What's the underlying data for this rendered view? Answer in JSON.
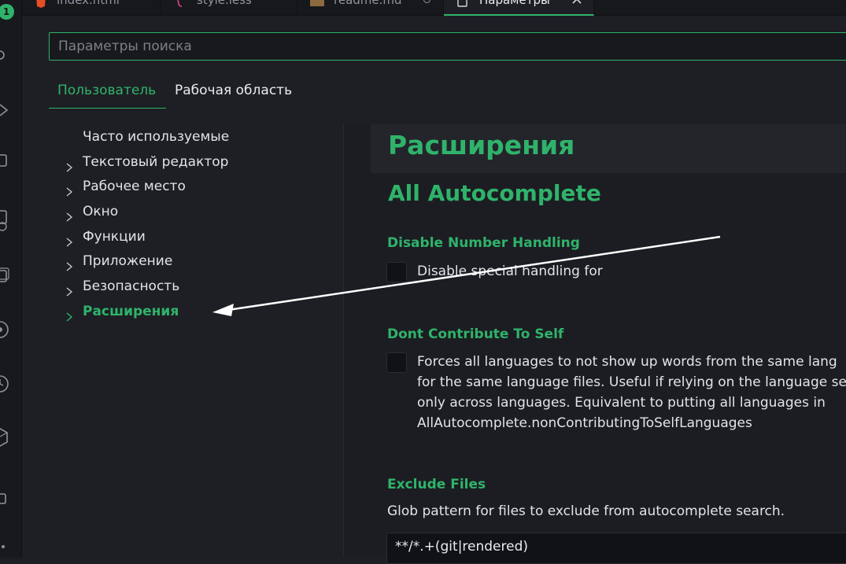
{
  "activity_bar": {
    "badge_count": "1"
  },
  "tabs": [
    {
      "label": "index.html",
      "icon": "html-file-icon",
      "icon_color": "#e44d26"
    },
    {
      "label": "style.less",
      "icon": "less-file-icon",
      "icon_color": "#d6478b"
    },
    {
      "label": "readme.md",
      "icon": "markdown-file-icon",
      "icon_color": "#8b6b3e"
    },
    {
      "label": "Параметры",
      "icon": "settings-file-icon",
      "icon_color": "#d4d6db"
    }
  ],
  "search": {
    "placeholder": "Параметры поиска",
    "value": ""
  },
  "scope_tabs": {
    "user": "Пользователь",
    "workspace": "Рабочая область"
  },
  "toc": [
    {
      "label": "Часто используемые",
      "expandable": false
    },
    {
      "label": "Текстовый редактор",
      "expandable": true
    },
    {
      "label": "Рабочее место",
      "expandable": true
    },
    {
      "label": "Окно",
      "expandable": true
    },
    {
      "label": "Функции",
      "expandable": true
    },
    {
      "label": "Приложение",
      "expandable": true
    },
    {
      "label": "Безопасность",
      "expandable": true
    },
    {
      "label": "Расширения",
      "expandable": true,
      "active": true
    }
  ],
  "content": {
    "section_title": "Расширения",
    "extension_title": "All Autocomplete",
    "settings": {
      "disable_number_handling": {
        "title": "Disable Number Handling",
        "description": "Disable special handling for",
        "checked": false
      },
      "dont_contribute_to_self": {
        "title": "Dont Contribute To Self",
        "lines": [
          "Forces all languages to not show up words from the same lang",
          "for the same language files. Useful if relying on the language se",
          "only across languages. Equivalent to putting all languages in",
          "AllAutocomplete.nonContributingToSelfLanguages"
        ],
        "checked": false
      },
      "exclude_files": {
        "title": "Exclude Files",
        "description": "Glob pattern for files to exclude from autocomplete search.",
        "value": "**/*.+(git|rendered)"
      }
    }
  },
  "colors": {
    "accent": "#2fb36b",
    "background": "#1e1f24",
    "text": "#e2e4e8"
  }
}
